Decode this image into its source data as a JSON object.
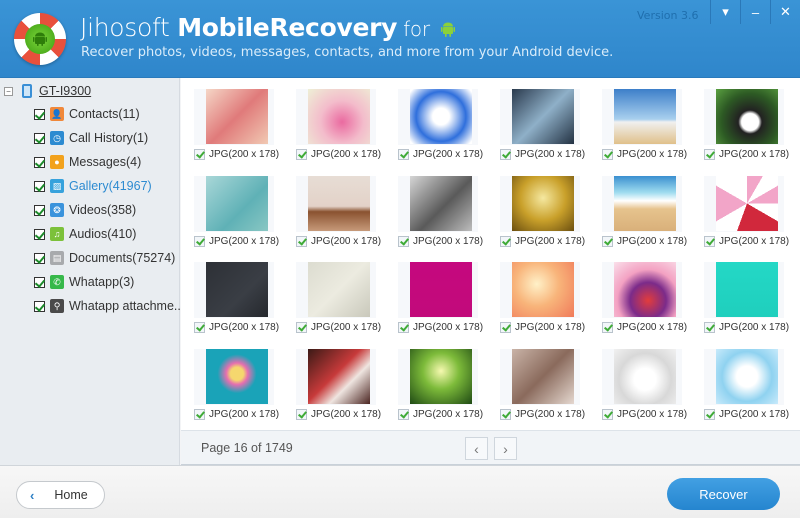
{
  "app": {
    "title_light": "Jihosoft ",
    "title_bold": "MobileRecovery",
    "title_for": " for",
    "subtitle": "Recover photos, videos, messages, contacts, and more from your Android device.",
    "version": "Version 3.6",
    "window_controls": {
      "menu": "▾",
      "minimize": "–",
      "close": "✕"
    }
  },
  "sidebar": {
    "expander": "−",
    "device": "GT-I9300",
    "items": [
      {
        "label": "Contacts(11)",
        "icon": "contacts-icon",
        "color": "#f0883a",
        "glyph": "👤",
        "active": false
      },
      {
        "label": "Call History(1)",
        "icon": "clock-icon",
        "color": "#2d8bd1",
        "glyph": "◷",
        "active": false
      },
      {
        "label": "Messages(4)",
        "icon": "message-icon",
        "color": "#f2a21d",
        "glyph": "●",
        "active": false
      },
      {
        "label": "Gallery(41967)",
        "icon": "gallery-icon",
        "color": "#37a2dc",
        "glyph": "▨",
        "active": true
      },
      {
        "label": "Videos(358)",
        "icon": "video-reel-icon",
        "color": "#3a93dc",
        "glyph": "❂",
        "active": false
      },
      {
        "label": "Audios(410)",
        "icon": "music-note-icon",
        "color": "#7cc13a",
        "glyph": "♫",
        "active": false
      },
      {
        "label": "Documents(75274)",
        "icon": "document-icon",
        "color": "#a8aaad",
        "glyph": "▤",
        "active": false
      },
      {
        "label": "Whatapp(3)",
        "icon": "phone-icon",
        "color": "#36b84a",
        "glyph": "✆",
        "active": false
      },
      {
        "label": "Whatapp attachme...",
        "icon": "attachment-icon",
        "color": "#4a4a4a",
        "glyph": "⚲",
        "active": false
      }
    ]
  },
  "gallery": {
    "items": [
      {
        "caption": "JPG(200 x 178)",
        "img": "linear-gradient(135deg,#f5d6c6,#e07a7a 50%,#f1c9b3)"
      },
      {
        "caption": "JPG(200 x 178)",
        "img": "radial-gradient(circle at 55% 60%,#ea6aa0,#f3bccb 45%,#eef0d6)"
      },
      {
        "caption": "JPG(200 x 178)",
        "img": "radial-gradient(circle at 50% 50%,#ffffff 20%,#2f6fdc 60%,#ffffff 95%)"
      },
      {
        "caption": "JPG(200 x 178)",
        "img": "linear-gradient(135deg,#2a3a4d,#8fb0c8 50%,#233243)"
      },
      {
        "caption": "JPG(200 x 178)",
        "img": "linear-gradient(#3d7fc9,#a9d0ee 55%,#f0f0f0 60%,#e0c08a)"
      },
      {
        "caption": "JPG(200 x 178)",
        "img": "radial-gradient(circle at 55% 60%,#ffffff 18%,#222 25%,#2d5a24 60%,#5aa140)"
      },
      {
        "caption": "JPG(200 x 178)",
        "img": "linear-gradient(135deg,#a9d7d8,#5fb1b6 60%,#89c7c3)"
      },
      {
        "caption": "JPG(200 x 178)",
        "img": "linear-gradient(#e7ddd5,#e3d2c8 55%,#8a5230 65%,#c79a7a)"
      },
      {
        "caption": "JPG(200 x 178)",
        "img": "linear-gradient(135deg,#d6d6d6,#5a5a5a 55%,#bdbdbd)"
      },
      {
        "caption": "JPG(200 x 178)",
        "img": "radial-gradient(circle at 50% 40%,#f5e8a0,#c9a02a 50%,#6b4f10)"
      },
      {
        "caption": "JPG(200 x 178)",
        "img": "linear-gradient(#3a8fd0,#9fdcef 30%,#ffffff 45%,#e6c38d 60%,#d9b07a)"
      },
      {
        "caption": "JPG(200 x 178)",
        "img": "conic-gradient(#f2a5c8 0 30deg,#fff 30deg 60deg,#f2a5c8 60deg 90deg,#fff 90deg 120deg,#d1283c 120deg 200deg,#fff 200deg 240deg,#f2a5c8 240deg 300deg,#fff 300deg 360deg)"
      },
      {
        "caption": "JPG(200 x 178)",
        "img": "linear-gradient(135deg,#2d3036,#3a3e45 60%,#25282d)"
      },
      {
        "caption": "JPG(200 x 178)",
        "img": "linear-gradient(135deg,#dcdcd0,#ecebe0 50%,#c9c8bb)"
      },
      {
        "caption": "JPG(200 x 178)",
        "img": "linear-gradient(#c5087e,#c20a7b)"
      },
      {
        "caption": "JPG(200 x 178)",
        "img": "radial-gradient(circle at 40% 40%,#fff1c8,#f8b47a 45%,#f07a5a)"
      },
      {
        "caption": "JPG(200 x 178)",
        "img": "radial-gradient(circle at 55% 70%,#e23c3c,#7b2b8a 35%,#f3a1c2 60%,#fae0ea)"
      },
      {
        "caption": "JPG(200 x 178)",
        "img": "linear-gradient(#24d8c6,#1fcfbd)"
      },
      {
        "caption": "JPG(200 x 178)",
        "img": "radial-gradient(circle at 50% 45%,#f5d76e 15%,#e56fb0 25%,#1aa3b8 45%)"
      },
      {
        "caption": "JPG(200 x 178)",
        "img": "linear-gradient(135deg,#3b1a16,#c73a3a 45%,#efe5e0 65%,#4a2420)"
      },
      {
        "caption": "JPG(200 x 178)",
        "img": "radial-gradient(circle at 50% 40%,#f6f9b0,#7dbb3a 40%,#1f4a14)"
      },
      {
        "caption": "JPG(200 x 178)",
        "img": "linear-gradient(135deg,#c9b3a7,#8a6a5c 50%,#e5d8d0)"
      },
      {
        "caption": "JPG(200 x 178)",
        "img": "radial-gradient(circle at 50% 55%,#ffffff 25%,#d8d8d8 60%,#f1f1f1)"
      },
      {
        "caption": "JPG(200 x 178)",
        "img": "radial-gradient(circle at 50% 50%,#ffffff 25%,#8fd2f0 60%,#c8eafb)"
      }
    ]
  },
  "pager": {
    "text": "Page 16 of 1749",
    "prev": "‹",
    "next": "›"
  },
  "footer": {
    "home_chevron": "‹",
    "home_label": "Home",
    "recover_label": "Recover"
  }
}
